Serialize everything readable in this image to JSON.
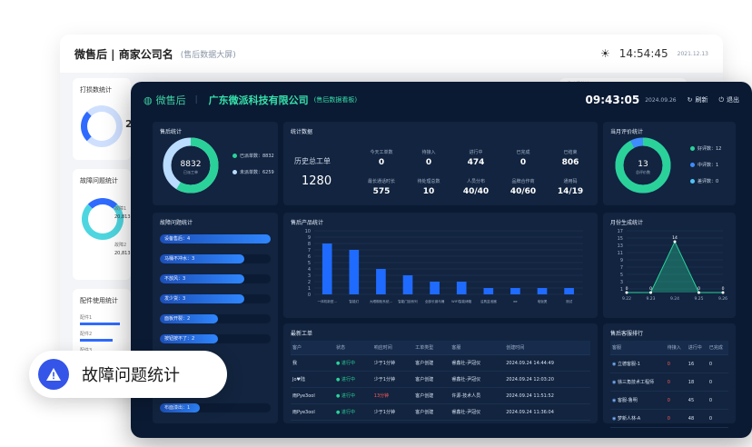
{
  "bg": {
    "title": "微售后 | 商家公司名",
    "subtitle": "(售后数据大屏)",
    "time": "14:54:45",
    "date": "2021.12.13",
    "cards": [
      "打损数统计",
      "故障问题统计",
      "配件使用统计"
    ],
    "card_num": "20,8",
    "card_small": [
      "故障1",
      "20,813",
      "故障2",
      "20,813"
    ],
    "parts_rows": [
      "配件1",
      "配件2",
      "配件3"
    ],
    "small_right": "发动机统计"
  },
  "header": {
    "logo": "微售后",
    "company": "广东微派科技有限公司",
    "company_sub": "(售后数据看板)",
    "time": "09:43:05",
    "date": "2024.09.26",
    "refresh": "刷新",
    "exit": "退出"
  },
  "after_sales": {
    "title": "售后统计",
    "center_value": "8832",
    "center_label": "已派工单",
    "legend": [
      {
        "label": "已派单数：8832",
        "color": "#2ad29a"
      },
      {
        "label": "未派单数：6259",
        "color": "#b9dcff"
      }
    ],
    "chart_data": {
      "type": "pie",
      "values": [
        8832,
        6259
      ],
      "categories": [
        "已派单数",
        "未派单数"
      ]
    }
  },
  "stats": {
    "title": "统计数据",
    "total_label": "历史总工单",
    "total_value": "1280",
    "items": [
      {
        "label": "今天工单数",
        "value": "0"
      },
      {
        "label": "待接入",
        "value": "0"
      },
      {
        "label": "进行中",
        "value": "474"
      },
      {
        "label": "已完成",
        "value": "0"
      },
      {
        "label": "已结束",
        "value": "806"
      },
      {
        "label": "最长通话时长",
        "value": "575"
      },
      {
        "label": "待处理总数",
        "value": "10"
      },
      {
        "label": "人员分布",
        "value": "40/40"
      },
      {
        "label": "品牌合作商",
        "value": "40/60"
      },
      {
        "label": "通用码",
        "value": "14/19"
      }
    ]
  },
  "evaluation": {
    "title": "当月评价统计",
    "center_value": "13",
    "center_label": "总评价数",
    "legend": [
      {
        "label": "好评数：12",
        "color": "#2ad29a"
      },
      {
        "label": "中评数：1",
        "color": "#3f8cff"
      },
      {
        "label": "差评数：0",
        "color": "#4fc3f7"
      }
    ],
    "chart_data": {
      "type": "pie",
      "values": [
        12,
        1,
        0
      ],
      "categories": [
        "好评数",
        "中评数",
        "差评数"
      ]
    }
  },
  "faults": {
    "title": "故障问题统计",
    "items": [
      {
        "label": "设备售后：4",
        "value": 4
      },
      {
        "label": "马桶不冲水：3",
        "value": 3
      },
      {
        "label": "不放风：3",
        "value": 3
      },
      {
        "label": "发少货：3",
        "value": 3
      },
      {
        "label": "面板开裂：2",
        "value": 2
      },
      {
        "label": "按钮按不了：2",
        "value": 2
      }
    ],
    "bottom_item": {
      "label": "布面漆出：1",
      "value": 1
    }
  },
  "products": {
    "title": "售后产品统计",
    "chart_data": {
      "type": "bar",
      "categories": [
        "一体机新型...",
        "智能灯",
        "大眼橱柜系统...",
        "智能门锁系列",
        "全部长钢马桶",
        "WIFI智能烤箱",
        "洁具盆池器",
        "ee",
        "电饭煲",
        "测试"
      ],
      "values": [
        8,
        7,
        4,
        3,
        2,
        2,
        1,
        1,
        1,
        1
      ],
      "ylim": [
        0,
        10
      ],
      "yticks": [
        "10",
        "9",
        "8",
        "7",
        "6",
        "5",
        "4",
        "3",
        "2",
        "1",
        "0"
      ]
    }
  },
  "trend": {
    "title": "月份生成统计",
    "chart_data": {
      "type": "line",
      "x": [
        "9.22",
        "9.23",
        "9.24",
        "9.25",
        "9.26"
      ],
      "values": [
        0,
        0,
        14,
        0,
        0
      ],
      "ylim": [
        0,
        17
      ],
      "yticks": [
        "17",
        "15",
        "13",
        "11",
        "9",
        "7",
        "5",
        "3",
        "1"
      ]
    },
    "point_labels": [
      "0",
      "0",
      "14",
      "0",
      "0"
    ]
  },
  "orders": {
    "title": "最新工单",
    "columns": [
      "客户",
      "状态",
      "响应时间",
      "工单类型",
      "客服",
      "创建时间"
    ],
    "rows": [
      [
        "我",
        "进行中",
        "少于1分钟",
        "客户创建",
        "睿鑫社-尹冠仪",
        "2024.09.24 14:44:49"
      ],
      [
        "Jo♥陆",
        "进行中",
        "少于1分钟",
        "客户创建",
        "睿鑫社-尹冠仪",
        "2024.09.24 12:03:20"
      ],
      [
        "雨Pye3ool",
        "进行中",
        "13分钟",
        "客户创建",
        "许源-技术人员",
        "2024.09.24 11:51:52"
      ],
      [
        "雨Pye3ool",
        "进行中",
        "少于1分钟",
        "客户创建",
        "睿鑫社-尹冠仪",
        "2024.09.24 11:36:04"
      ]
    ]
  },
  "ranking": {
    "title": "售后客服排行",
    "columns": [
      "客服",
      "待接入",
      "进行中",
      "已完成"
    ],
    "rows": [
      [
        "立德客服-1",
        "0",
        "16",
        "0"
      ],
      [
        "徐三角技术工程师",
        "0",
        "18",
        "0"
      ],
      [
        "客服-鲁明",
        "0",
        "45",
        "0"
      ],
      [
        "梦新人林-A",
        "0",
        "48",
        "0"
      ]
    ]
  },
  "callout": {
    "text": "故障问题统计"
  }
}
